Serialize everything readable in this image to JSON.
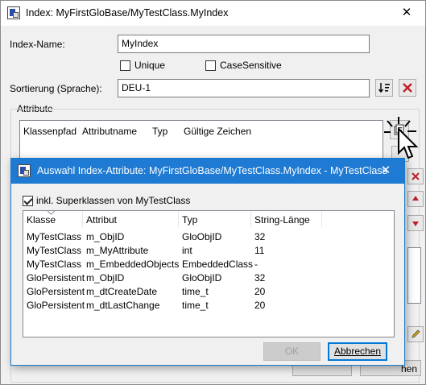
{
  "main_window": {
    "title": "Index: MyFirstGloBase/MyTestClass.MyIndex",
    "close_glyph": "✕",
    "index_name_label": "Index-Name:",
    "index_name_value": "MyIndex",
    "unique_label": "Unique",
    "unique_checked": false,
    "case_sensitive_label": "CaseSensitive",
    "case_sensitive_checked": false,
    "sort_label": "Sortierung (Sprache):",
    "sort_value": "DEU-1",
    "attributes_group_label": "Attribute",
    "attribute_columns": [
      "Klassenpfad",
      "Attributname",
      "Typ",
      "Gültige Zeichen"
    ],
    "hidden_button_partial_1": "",
    "hidden_button_partial_2": "hen"
  },
  "dialog": {
    "title": "Auswahl Index-Attribute: MyFirstGloBase/MyTestClass.MyIndex - MyTestClass",
    "close_glyph": "✕",
    "include_super_label": "inkl. Superklassen von MyTestClass",
    "include_super_checked": true,
    "columns": [
      "Klasse",
      "Attribut",
      "Typ",
      "String-Länge"
    ],
    "rows": [
      [
        "MyTestClass",
        "m_ObjID",
        "GloObjID",
        "32"
      ],
      [
        "MyTestClass",
        "m_MyAttribute",
        "int",
        "11"
      ],
      [
        "MyTestClass",
        "m_EmbeddedObjects",
        "EmbeddedClass",
        "-"
      ],
      [
        "GloPersistent",
        "m_ObjID",
        "GloObjID",
        "32"
      ],
      [
        "GloPersistent",
        "m_dtCreateDate",
        "time_t",
        "20"
      ],
      [
        "GloPersistent",
        "m_dtLastChange",
        "time_t",
        "20"
      ]
    ],
    "ok_label": "OK",
    "cancel_label": "Abbrechen"
  },
  "icons": {
    "sort": "sort-icon",
    "delete": "delete-icon",
    "add_attribute": "add-attribute-icon",
    "cursor": "mouse-cursor-icon"
  },
  "colors": {
    "dialog_titlebar": "#1e7ad2",
    "delete_red": "#c0202a",
    "window_bg": "#f0f0f0"
  }
}
